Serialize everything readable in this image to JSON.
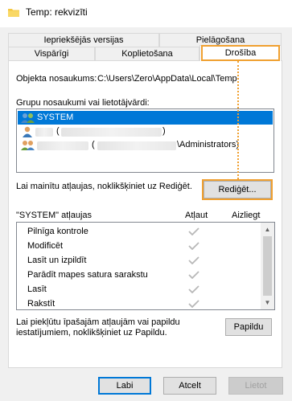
{
  "window": {
    "title": "Temp: rekvizīti"
  },
  "tabs_back": [
    "Iepriekšējās versijas",
    "Pielāgošana"
  ],
  "tabs_front": [
    "Vispārīgi",
    "Koplietošana",
    "Drošība"
  ],
  "object": {
    "label": "Objekta nosaukums:",
    "value": "C:\\Users\\Zero\\AppData\\Local\\Temp"
  },
  "groups": {
    "label": "Grupu nosaukumi vai lietotājvārdi:",
    "items": [
      {
        "name": "SYSTEM"
      },
      {
        "name": "(",
        "suffix": ")"
      },
      {
        "name": "(",
        "suffix": "\\Administrators)"
      }
    ]
  },
  "edit": {
    "hint": "Lai mainītu atļaujas, noklikšķiniet uz Rediģēt.",
    "button": "Rediģēt..."
  },
  "permissions": {
    "title": "\"SYSTEM\" atļaujas",
    "col_allow": "Atļaut",
    "col_deny": "Aizliegt",
    "rows": [
      {
        "label": "Pilnīga kontrole",
        "allow": true,
        "deny": false
      },
      {
        "label": "Modificēt",
        "allow": true,
        "deny": false
      },
      {
        "label": "Lasīt un izpildīt",
        "allow": true,
        "deny": false
      },
      {
        "label": "Parādīt mapes satura sarakstu",
        "allow": true,
        "deny": false
      },
      {
        "label": "Lasīt",
        "allow": true,
        "deny": false
      },
      {
        "label": "Rakstīt",
        "allow": true,
        "deny": false
      }
    ]
  },
  "advanced": {
    "hint_line1": "Lai piekļūtu īpašajām atļaujām vai papildu",
    "hint_line2": "iestatījumiem, noklikšķiniet uz Papildu.",
    "button": "Papildu"
  },
  "footer": {
    "ok": "Labi",
    "cancel": "Atcelt",
    "apply": "Lietot"
  },
  "icons": {
    "folder": "folder-icon",
    "user": "user-icon",
    "users": "users-icon",
    "check": "checkmark-icon",
    "scroll_up": "scroll-up-icon",
    "scroll_down": "scroll-down-icon"
  },
  "colors": {
    "selection": "#0078d7",
    "highlight": "#f0a030",
    "folder": "#f5c842"
  }
}
